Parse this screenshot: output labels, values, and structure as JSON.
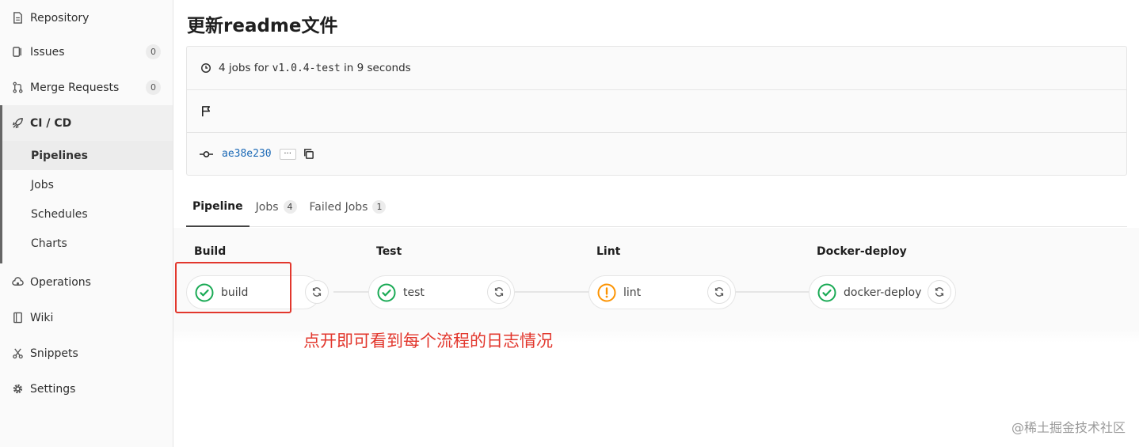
{
  "sidebar": {
    "repository": "Repository",
    "issues": {
      "label": "Issues",
      "count": "0"
    },
    "merge_requests": {
      "label": "Merge Requests",
      "count": "0"
    },
    "cicd": "CI / CD",
    "sub": [
      "Pipelines",
      "Jobs",
      "Schedules",
      "Charts"
    ],
    "operations": "Operations",
    "wiki": "Wiki",
    "snippets": "Snippets",
    "settings": "Settings"
  },
  "page": {
    "title": "更新readme文件",
    "jobs_prefix": "4 jobs for ",
    "ref": "v1.0.4-test",
    "jobs_suffix": " in 9 seconds",
    "sha": "ae38e230",
    "ellipsis": "···"
  },
  "tabs": [
    {
      "label": "Pipeline"
    },
    {
      "label": "Jobs",
      "count": "4"
    },
    {
      "label": "Failed Jobs",
      "count": "1"
    }
  ],
  "stages": [
    {
      "title": "Build",
      "job": "build",
      "status": "success"
    },
    {
      "title": "Test",
      "job": "test",
      "status": "success"
    },
    {
      "title": "Lint",
      "job": "lint",
      "status": "warning"
    },
    {
      "title": "Docker-deploy",
      "job": "docker-deploy",
      "status": "success"
    }
  ],
  "annotation": "点开即可看到每个流程的日志情况",
  "watermark": "@稀土掘金技术社区",
  "colors": {
    "success": "#1aaa55",
    "warning": "#fc9403",
    "annotation": "#e2372d",
    "link": "#1b69b6"
  }
}
